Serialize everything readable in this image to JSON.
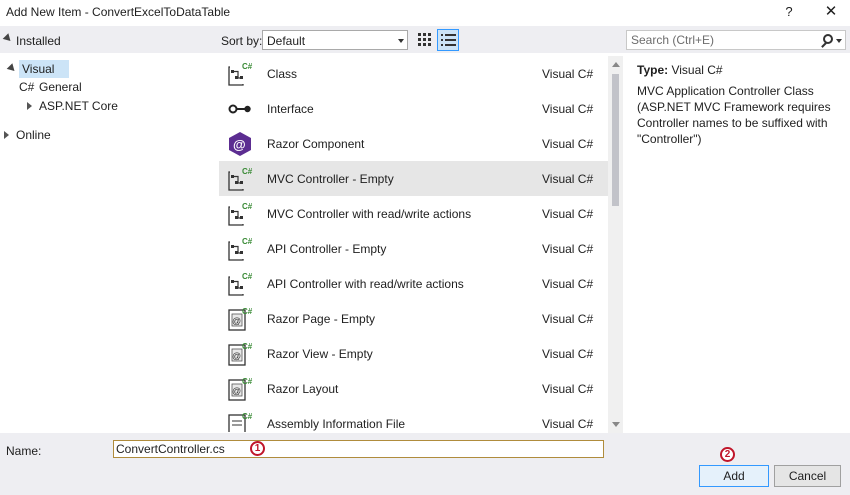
{
  "window": {
    "title": "Add New Item - ConvertExcelToDataTable",
    "help_glyph": "?",
    "close_glyph": "✕"
  },
  "toolbar": {
    "installed_label": "Installed",
    "sort_by_label": "Sort by:",
    "sort_value": "Default",
    "search_placeholder": "Search (Ctrl+E)"
  },
  "tree": {
    "items": [
      {
        "label": "Visual C#"
      },
      {
        "label": "General"
      },
      {
        "label": "ASP.NET Core"
      },
      {
        "label": "Online"
      }
    ]
  },
  "templates": [
    {
      "name": "Class",
      "lang": "Visual C#",
      "icon": "class-icon"
    },
    {
      "name": "Interface",
      "lang": "Visual C#",
      "icon": "interface-icon"
    },
    {
      "name": "Razor Component",
      "lang": "Visual C#",
      "icon": "razor-component-icon"
    },
    {
      "name": "MVC Controller - Empty",
      "lang": "Visual C#",
      "icon": "controller-icon"
    },
    {
      "name": "MVC Controller with read/write actions",
      "lang": "Visual C#",
      "icon": "controller-icon"
    },
    {
      "name": "API Controller - Empty",
      "lang": "Visual C#",
      "icon": "controller-icon"
    },
    {
      "name": "API Controller with read/write actions",
      "lang": "Visual C#",
      "icon": "controller-icon"
    },
    {
      "name": "Razor Page - Empty",
      "lang": "Visual C#",
      "icon": "razor-page-icon"
    },
    {
      "name": "Razor View - Empty",
      "lang": "Visual C#",
      "icon": "razor-view-icon"
    },
    {
      "name": "Razor Layout",
      "lang": "Visual C#",
      "icon": "razor-layout-icon"
    },
    {
      "name": "Assembly Information File",
      "lang": "Visual C#",
      "icon": "assembly-info-icon"
    }
  ],
  "description": {
    "type_label": "Type:",
    "type_value": "Visual C#",
    "text": "MVC Application Controller Class (ASP.NET MVC Framework requires Controller names to be suffixed with \"Controller\")"
  },
  "footer": {
    "name_label": "Name:",
    "name_value": "ConvertController.cs",
    "add_label": "Add",
    "cancel_label": "Cancel",
    "marker_1": "1",
    "marker_2": "2"
  },
  "colors": {
    "selection": "#cce4f7",
    "marker": "#c0162b",
    "chrome": "#eeeef2",
    "csharp_badge": "#388a34",
    "razor_purple": "#5c2d91"
  }
}
